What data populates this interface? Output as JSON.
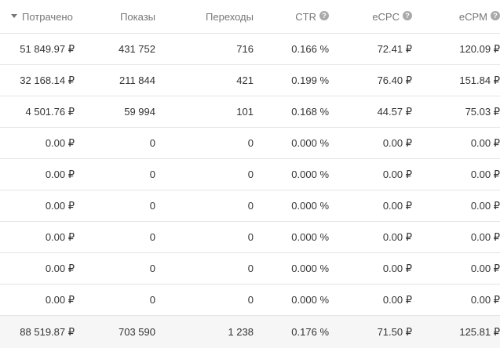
{
  "table": {
    "columns": [
      {
        "label": "Потрачено",
        "sorted": true,
        "help": false
      },
      {
        "label": "Показы",
        "sorted": false,
        "help": false
      },
      {
        "label": "Переходы",
        "sorted": false,
        "help": false
      },
      {
        "label": "CTR",
        "sorted": false,
        "help": true
      },
      {
        "label": "eCPC",
        "sorted": false,
        "help": true
      },
      {
        "label": "eCPM",
        "sorted": false,
        "help": true
      }
    ],
    "help_glyph": "?",
    "rows": [
      [
        "51 849.97 ₽",
        "431 752",
        "716",
        "0.166 %",
        "72.41 ₽",
        "120.09 ₽"
      ],
      [
        "32 168.14 ₽",
        "211 844",
        "421",
        "0.199 %",
        "76.40 ₽",
        "151.84 ₽"
      ],
      [
        "4 501.76 ₽",
        "59 994",
        "101",
        "0.168 %",
        "44.57 ₽",
        "75.03 ₽"
      ],
      [
        "0.00 ₽",
        "0",
        "0",
        "0.000 %",
        "0.00 ₽",
        "0.00 ₽"
      ],
      [
        "0.00 ₽",
        "0",
        "0",
        "0.000 %",
        "0.00 ₽",
        "0.00 ₽"
      ],
      [
        "0.00 ₽",
        "0",
        "0",
        "0.000 %",
        "0.00 ₽",
        "0.00 ₽"
      ],
      [
        "0.00 ₽",
        "0",
        "0",
        "0.000 %",
        "0.00 ₽",
        "0.00 ₽"
      ],
      [
        "0.00 ₽",
        "0",
        "0",
        "0.000 %",
        "0.00 ₽",
        "0.00 ₽"
      ],
      [
        "0.00 ₽",
        "0",
        "0",
        "0.000 %",
        "0.00 ₽",
        "0.00 ₽"
      ]
    ],
    "total": [
      "88 519.87 ₽",
      "703 590",
      "1 238",
      "0.176 %",
      "71.50 ₽",
      "125.81 ₽"
    ]
  },
  "colors": {
    "header_text": "#777777",
    "body_text": "#333333",
    "divider": "#e4e4e4",
    "total_background": "#f6f6f6",
    "help_icon": "#a9a9a9"
  },
  "icons": {
    "sort": "sort-descending-icon",
    "help": "help-circle-icon"
  }
}
